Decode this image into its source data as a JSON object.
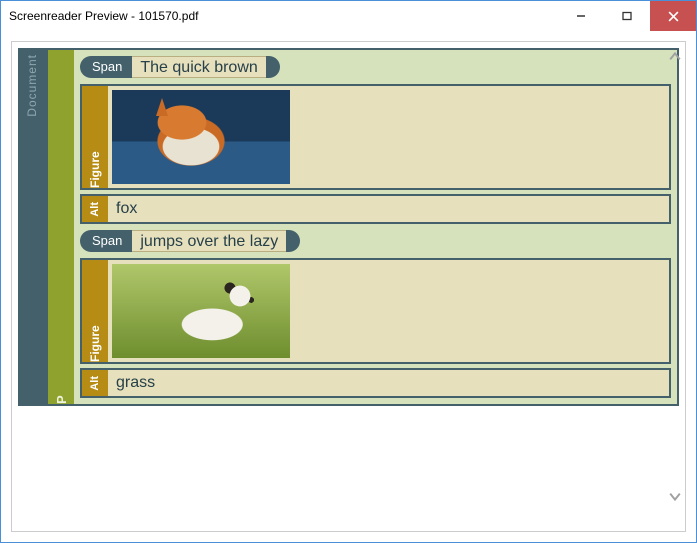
{
  "window": {
    "title": "Screenreader Preview - 101570.pdf"
  },
  "structure": {
    "document_label": "Document",
    "p_label": "P",
    "figure_label": "Figure",
    "alt_label": "Alt",
    "span_tag": "Span"
  },
  "content": {
    "span1_text": "The quick brown",
    "alt1_text": "fox",
    "span2_text": "jumps over the lazy",
    "alt2_text": "grass"
  }
}
